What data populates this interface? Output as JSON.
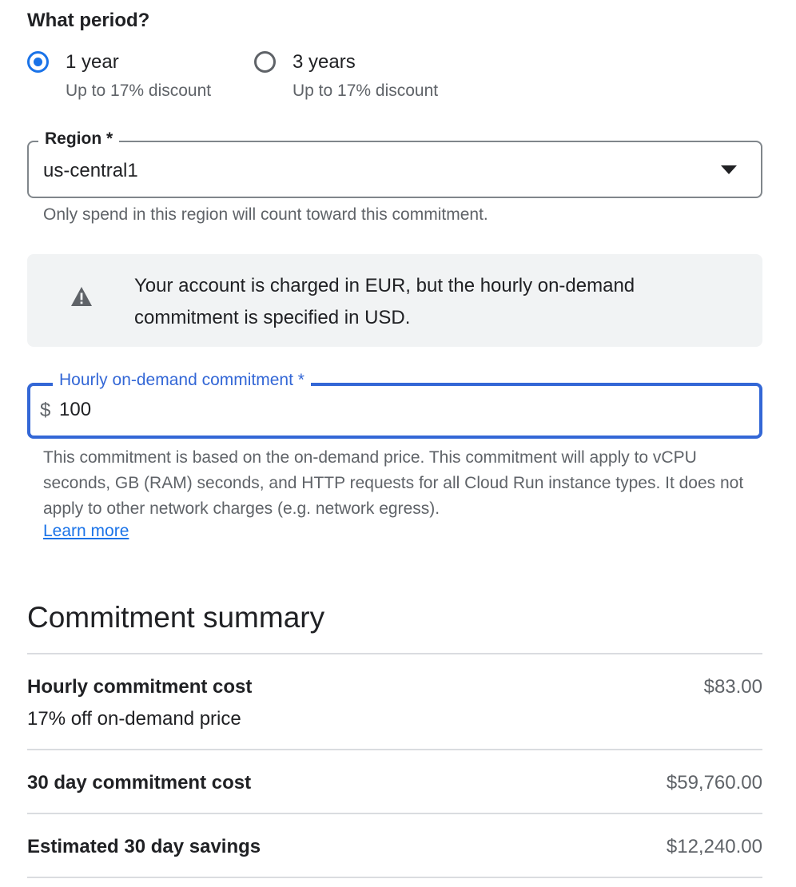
{
  "period": {
    "heading": "What period?",
    "options": [
      {
        "label": "1 year",
        "sublabel": "Up to 17% discount",
        "selected": true
      },
      {
        "label": "3 years",
        "sublabel": "Up to 17% discount",
        "selected": false
      }
    ]
  },
  "region": {
    "label": "Region *",
    "value": "us-central1",
    "hint": "Only spend in this region will count toward this commitment."
  },
  "notice": {
    "icon": "warning-icon",
    "text": "Your account is charged in EUR, but the hourly on-demand commitment is specified in USD."
  },
  "commitment": {
    "label": "Hourly on-demand commitment *",
    "prefix": "$",
    "value": "100",
    "hint": "This commitment is based on the on-demand price. This commitment will apply to vCPU seconds, GB (RAM) seconds, and HTTP requests for all Cloud Run instance types. It does not apply to other network charges (e.g. network egress).",
    "learn_more": "Learn more"
  },
  "summary": {
    "title": "Commitment summary",
    "rows": [
      {
        "label": "Hourly commitment cost",
        "sublabel": "17% off on-demand price",
        "value": "$83.00"
      },
      {
        "label": "30 day commitment cost",
        "value": "$59,760.00"
      },
      {
        "label": "Estimated 30 day savings",
        "value": "$12,240.00"
      }
    ]
  },
  "colors": {
    "accent": "#1a73e8",
    "focus_border": "#3367d6",
    "secondary_text": "#5f6368",
    "notice_bg": "#f1f3f4",
    "divider": "#dadce0"
  }
}
